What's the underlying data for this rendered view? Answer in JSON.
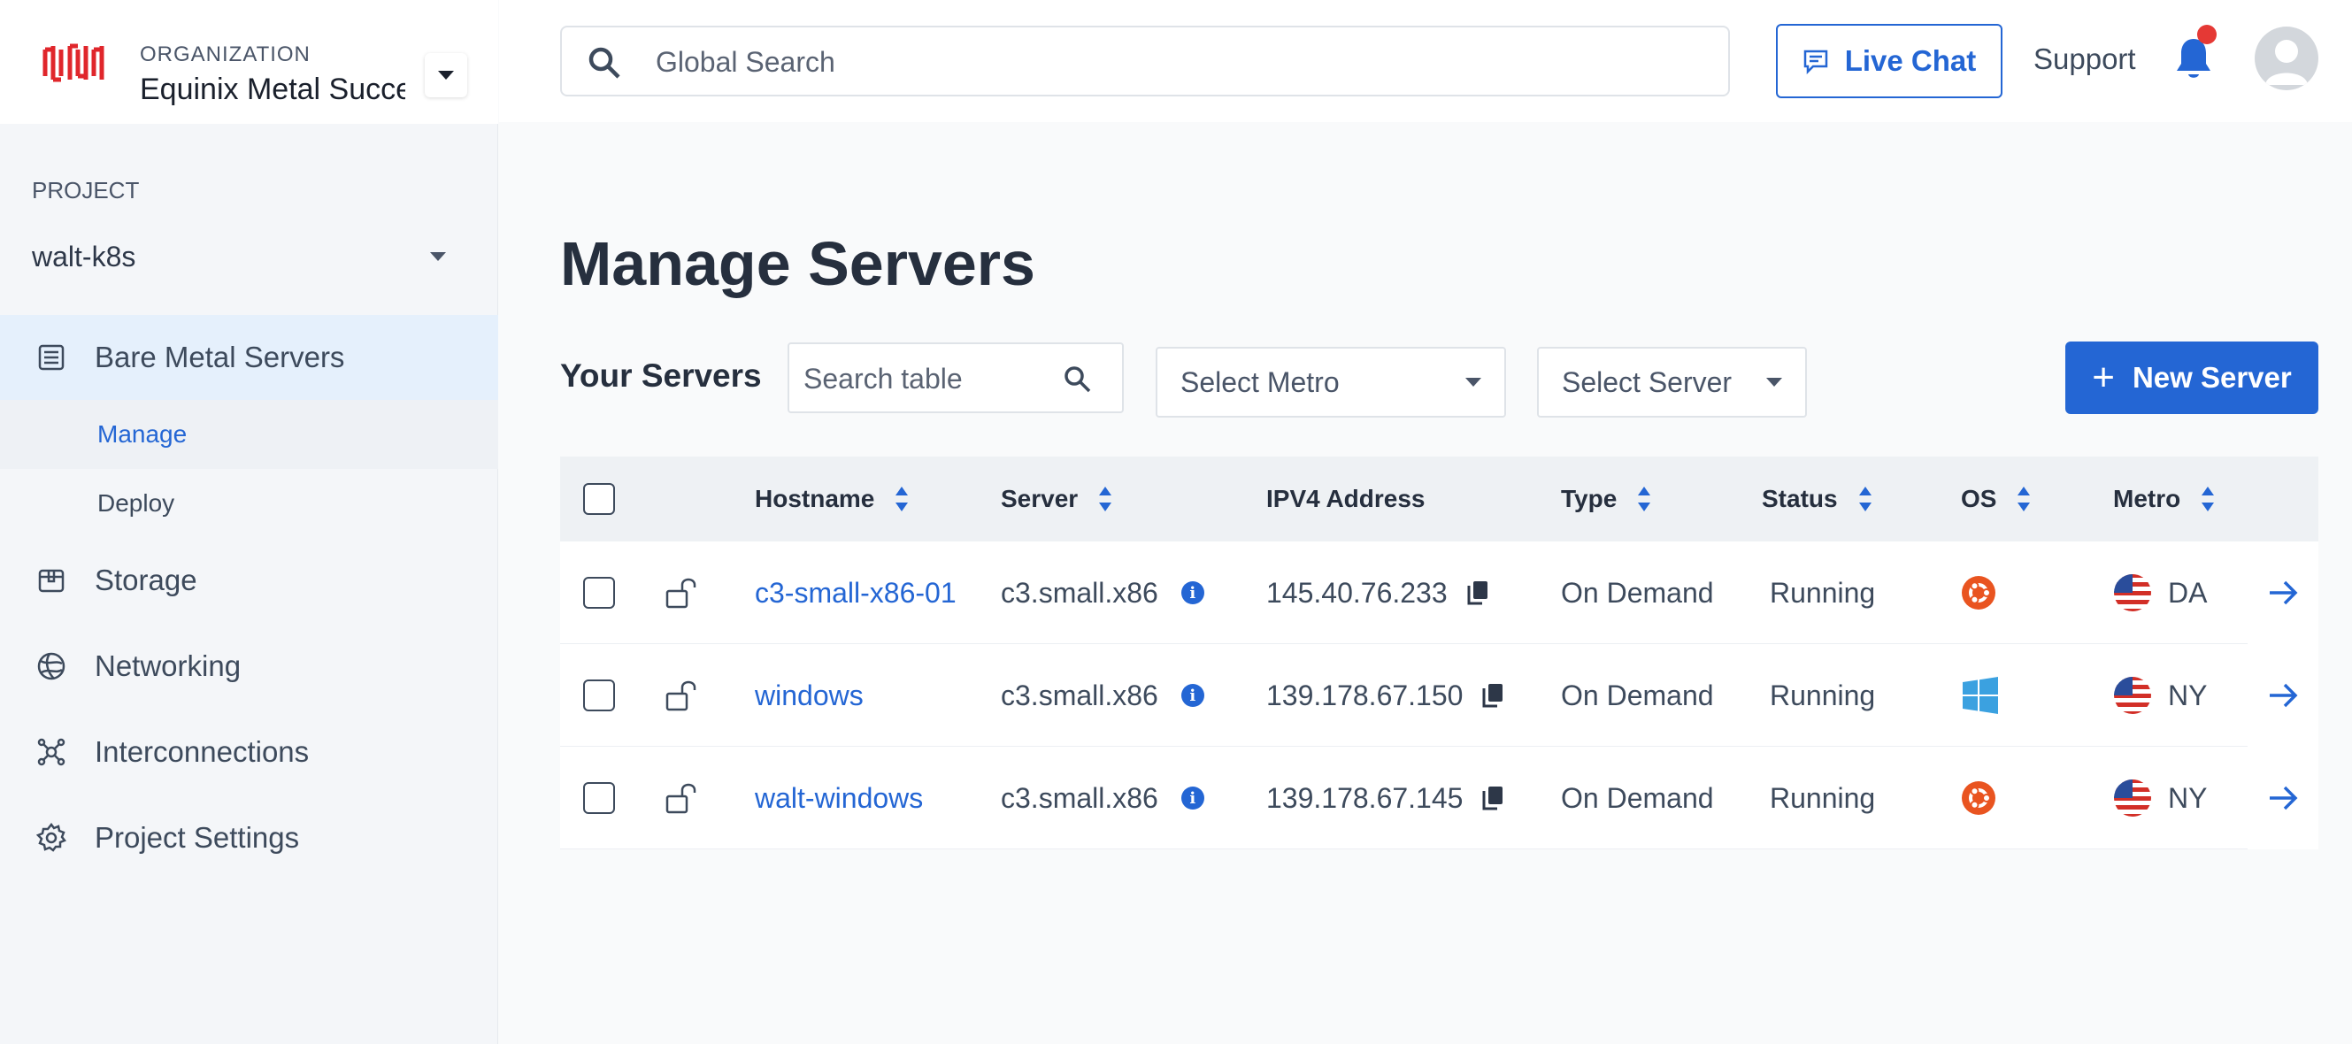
{
  "organization": {
    "caption": "ORGANIZATION",
    "name": "Equinix Metal Success"
  },
  "project": {
    "caption": "PROJECT",
    "name": "walt-k8s"
  },
  "sidebar": {
    "items": [
      {
        "label": "Bare Metal Servers",
        "icon": "server-icon",
        "active": true
      },
      {
        "label": "Storage",
        "icon": "storage-box-icon"
      },
      {
        "label": "Networking",
        "icon": "globe-icon"
      },
      {
        "label": "Interconnections",
        "icon": "interconnect-icon"
      },
      {
        "label": "Project Settings",
        "icon": "gear-icon"
      }
    ],
    "subitems": [
      {
        "label": "Manage",
        "active": true
      },
      {
        "label": "Deploy"
      }
    ]
  },
  "topbar": {
    "search_placeholder": "Global Search",
    "live_chat": "Live Chat",
    "support": "Support"
  },
  "page": {
    "title": "Manage Servers",
    "section": "Your Servers",
    "table_search_placeholder": "Search table",
    "metro_select": "Select Metro",
    "server_select": "Select Server",
    "new_server": "New Server"
  },
  "table": {
    "columns": [
      "Hostname",
      "Server",
      "IPV4 Address",
      "Type",
      "Status",
      "OS",
      "Metro"
    ],
    "rows": [
      {
        "hostname": "c3-small-x86-01",
        "server": "c3.small.x86",
        "ipv4": "145.40.76.233",
        "type": "On Demand",
        "status": "Running",
        "os": "ubuntu-icon",
        "metro": "DA"
      },
      {
        "hostname": "windows",
        "server": "c3.small.x86",
        "ipv4": "139.178.67.150",
        "type": "On Demand",
        "status": "Running",
        "os": "windows-icon",
        "metro": "NY"
      },
      {
        "hostname": "walt-windows",
        "server": "c3.small.x86",
        "ipv4": "139.178.67.145",
        "type": "On Demand",
        "status": "Running",
        "os": "ubuntu-icon",
        "metro": "NY"
      }
    ]
  },
  "colors": {
    "accent": "#2466d4",
    "brand_red": "#e0262b",
    "ubuntu": "#e95420",
    "windows": "#3ba1e0",
    "notification": "#e53935"
  }
}
